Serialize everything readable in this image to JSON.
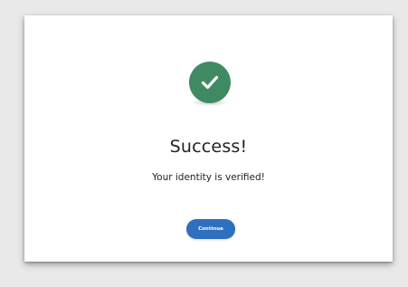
{
  "dialog": {
    "icon": "checkmark-circle-icon",
    "title": "Success!",
    "message": "Your identity is verified!",
    "continue_label": "Continue"
  },
  "colors": {
    "background": "#e9e9e9",
    "card": "#ffffff",
    "success_green": "#3f8a63",
    "button_blue": "#2f6fbf",
    "text": "#222222"
  }
}
